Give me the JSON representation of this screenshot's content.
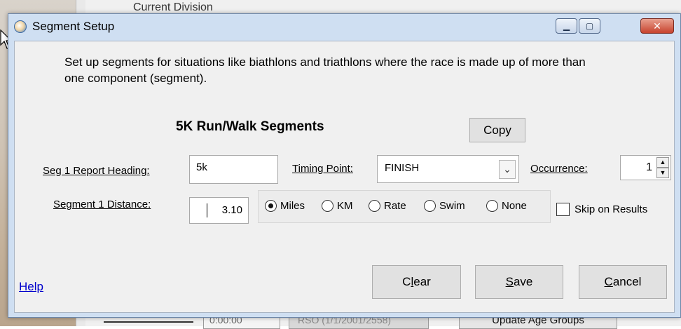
{
  "background": {
    "top_text": "Current Division",
    "bottom_field": "0:00:00",
    "bottom_gray": "RSO (1/1/2001/2558)",
    "bottom_button": "Update Age Groups"
  },
  "window": {
    "title": "Segment Setup",
    "minimize_glyph": "▁",
    "maximize_glyph": "▢",
    "close_glyph": "✕"
  },
  "dialog": {
    "description": "Set up segments for situations like biathlons and triathlons where the race is made up of more than one component (segment).",
    "segments_heading": "5K Run/Walk Segments",
    "copy_button": "Copy",
    "report_heading_label": "Seg 1 Report Heading:",
    "report_heading_value": "5k",
    "timing_point_label": "Timing Point:",
    "timing_point_value": "FINISH",
    "occurrence_label": "Occurrence:",
    "occurrence_value": "1",
    "distance_label": "Segment 1 Distance:",
    "distance_value": "3.10",
    "units": [
      {
        "label": "Miles",
        "selected": true
      },
      {
        "label": "KM",
        "selected": false
      },
      {
        "label": "Rate",
        "selected": false
      },
      {
        "label": "Swim",
        "selected": false
      },
      {
        "label": "None",
        "selected": false
      }
    ],
    "skip_on_results_label": "Skip on Results",
    "skip_on_results_checked": false,
    "help_link": "Help",
    "clear_button": {
      "pre": "C",
      "accel": "l",
      "post": "ear"
    },
    "save_button": {
      "pre": "",
      "accel": "S",
      "post": "ave"
    },
    "cancel_button": {
      "pre": "",
      "accel": "C",
      "post": "ancel"
    }
  },
  "colors": {
    "window_frame": "#cfdff2",
    "client_bg": "#f0f0f0",
    "link": "#0000cc",
    "close_button": "#c7432e"
  }
}
